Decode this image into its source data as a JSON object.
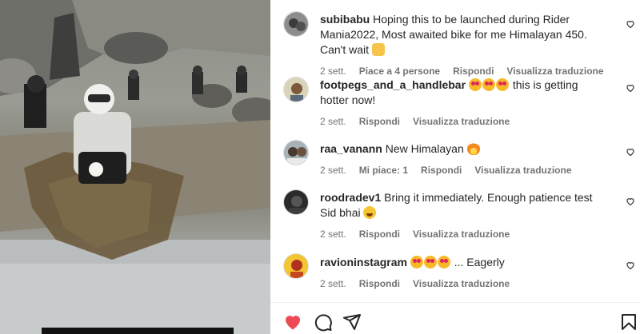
{
  "media": {
    "description_icon": "video-frame"
  },
  "comments": [
    {
      "username": "subibabu",
      "text": "Hoping this to be launched during Rider Mania2022, Most awaited bike for me Himalayan 450. Can't wait",
      "emojis": [
        "pray"
      ],
      "age": "2 sett.",
      "likes": "Piace a 4 persone",
      "reply": "Rispondi",
      "translate": "Visualizza traduzione"
    },
    {
      "username": "footpegs_and_a_handlebar",
      "text": "this is getting hotter now!",
      "emojis": [
        "heart-eyes",
        "heart-eyes",
        "heart-eyes"
      ],
      "age": "2 sett.",
      "likes": "",
      "reply": "Rispondi",
      "translate": "Visualizza traduzione"
    },
    {
      "username": "raa_vanann",
      "text": "New Himalayan",
      "emojis": [
        "fire"
      ],
      "age": "2 sett.",
      "likes": "Mi piace: 1",
      "reply": "Rispondi",
      "translate": "Visualizza traduzione"
    },
    {
      "username": "roodradev1",
      "text": "Bring it immediately. Enough patience test Sid bhai",
      "emojis": [
        "laugh"
      ],
      "age": "2 sett.",
      "likes": "",
      "reply": "Rispondi",
      "translate": "Visualizza traduzione"
    },
    {
      "username": "ravioninstagram",
      "text": "... Eagerly",
      "emojis": [
        "heart-eyes",
        "heart-eyes",
        "heart-eyes"
      ],
      "age": "2 sett.",
      "likes": "",
      "reply": "Rispondi",
      "translate": "Visualizza traduzione"
    }
  ],
  "actions": {
    "like_icon": "heart-filled-icon",
    "comment_icon": "comment-icon",
    "share_icon": "share-icon",
    "save_icon": "bookmark-icon",
    "like_color": "#ed4956"
  }
}
